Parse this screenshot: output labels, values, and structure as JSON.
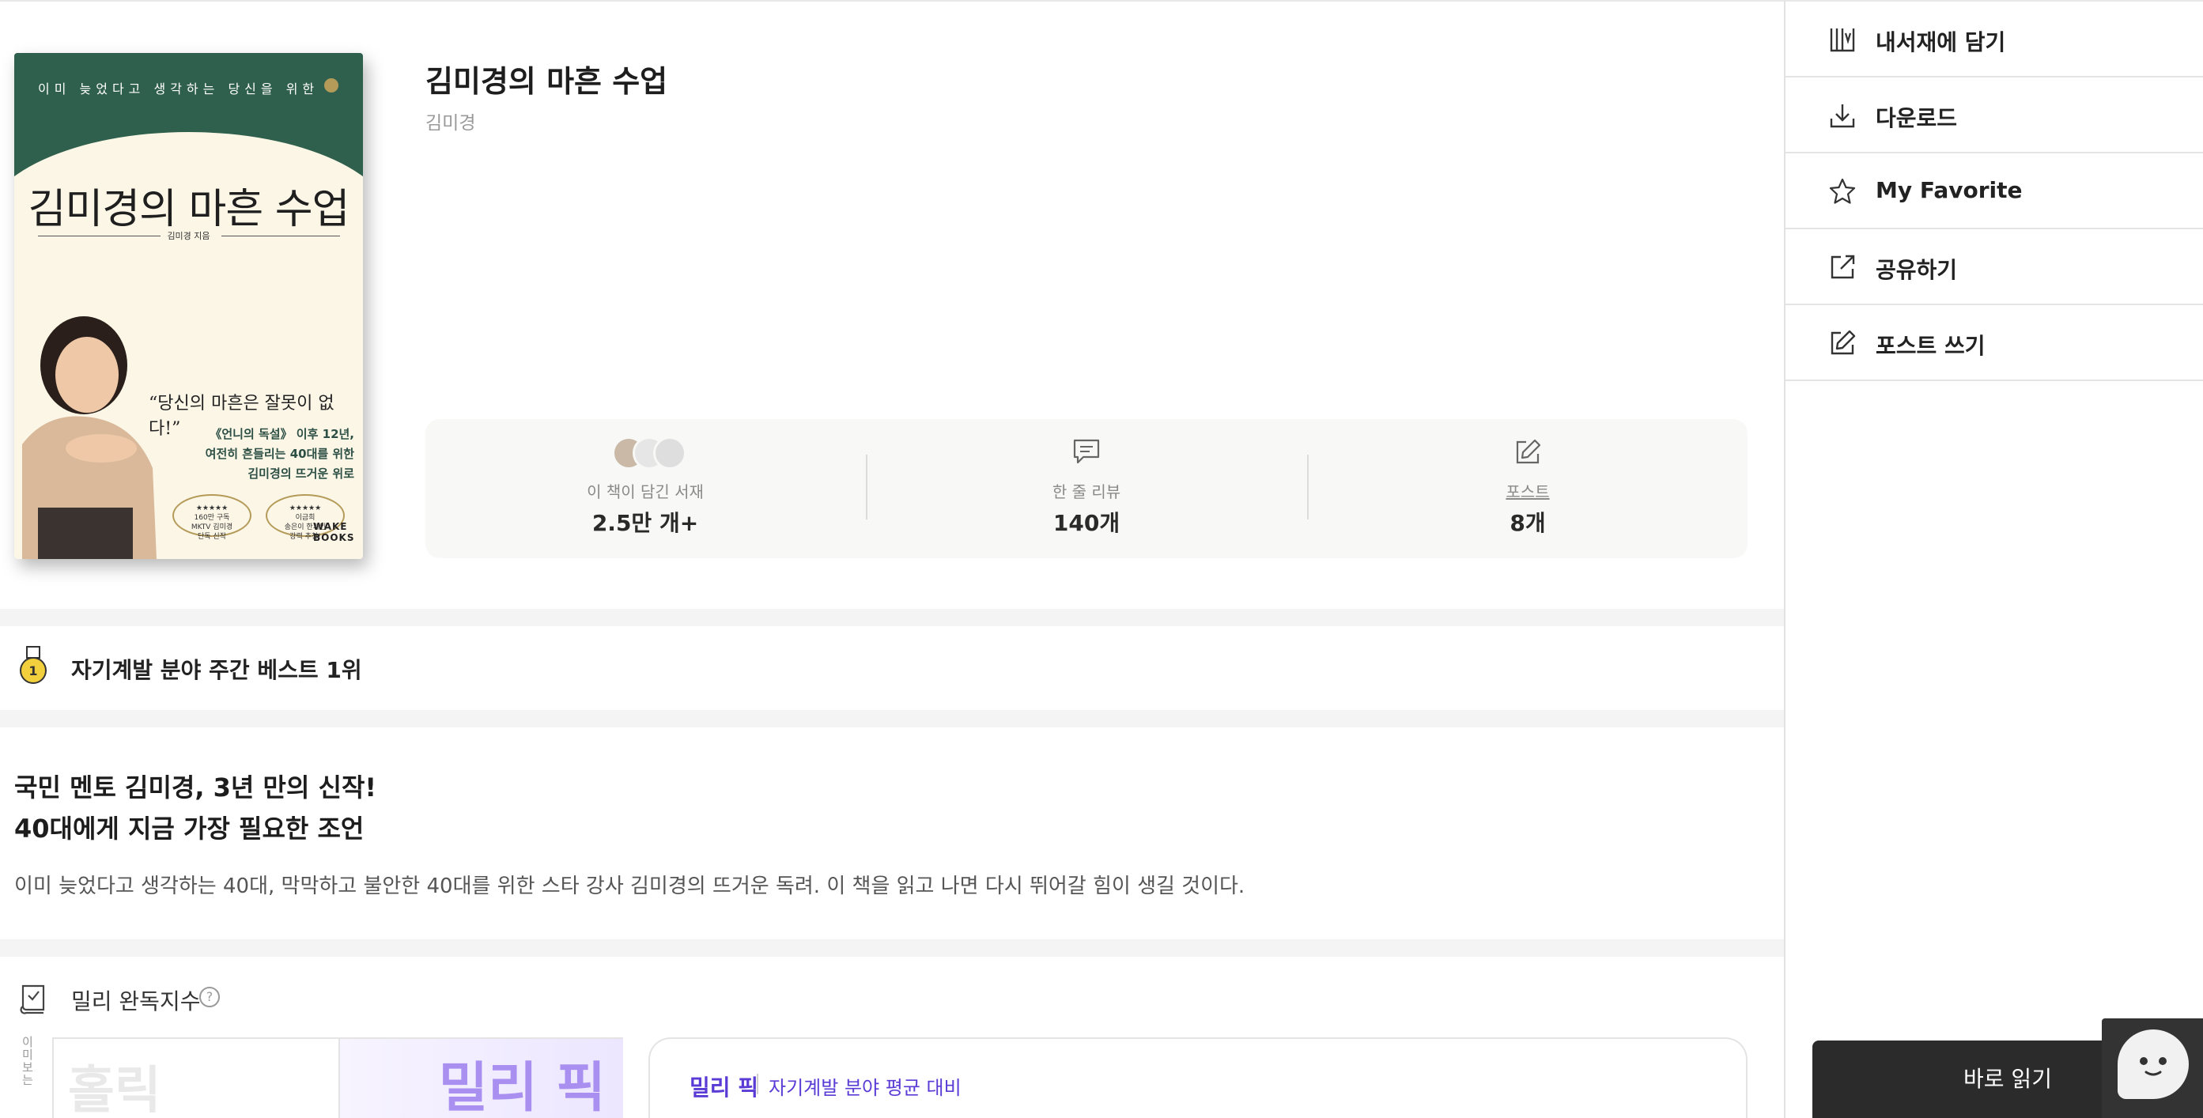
{
  "book": {
    "title": "김미경의 마흔 수업",
    "author": "김미경",
    "cover": {
      "tagline": "이미 늦었다고 생각하는 당신을 위한",
      "title": "김미경의 마흔 수업",
      "author_credit": "김미경 지음",
      "quote": "“당신의 마흔은 잘못이 없다!”",
      "sub_lines": [
        "《언니의 독설》 이후 12년,",
        "여전히 흔들리는 40대를 위한",
        "김미경의 뜨거운 위로"
      ],
      "badge_left": [
        "★★★★★",
        "160만 구독",
        "MKTV 김미경",
        "단독 신작"
      ],
      "badge_right": [
        "★★★★★",
        "이금희",
        "송은이 한가인",
        "강력 추천!"
      ],
      "publisher": "WAKE BOOKS"
    }
  },
  "stats": [
    {
      "label": "이 책이 담긴 서재",
      "value": "2.5만 개+"
    },
    {
      "label": "한 줄 리뷰",
      "value": "140개"
    },
    {
      "label": "포스트",
      "value": "8개"
    }
  ],
  "best": {
    "label": "자기계발 분야 주간 베스트 1위",
    "rank": "1"
  },
  "promo": {
    "line1": "국민 멘토 김미경, 3년 만의 신작!",
    "line2": "40대에게 지금 가장 필요한 조언",
    "desc": "이미 늦었다고 생각하는 40대, 막막하고 불안한 40대를 위한 스타 강사 김미경의 뜨거운 독려. 이 책을 읽고 나면 다시 뛰어갈 힘이 생길 것이다."
  },
  "read_index": {
    "title": "밀리 완독지수",
    "help": "?",
    "axis_label": "이미 보는",
    "left_label": "홀릭",
    "right_label": "밀리 픽",
    "card_pick": "밀리 픽",
    "card_sub": "자기계발 분야 평균 대비"
  },
  "sidebar": {
    "items": [
      {
        "label": "내서재에 담기",
        "icon": "library-add-icon"
      },
      {
        "label": "다운로드",
        "icon": "download-icon"
      },
      {
        "label": "My Favorite",
        "icon": "star-icon"
      },
      {
        "label": "공유하기",
        "icon": "share-icon"
      },
      {
        "label": "포스트 쓰기",
        "icon": "edit-icon"
      }
    ]
  },
  "cta": {
    "read_now": "바로 읽기"
  },
  "colors": {
    "accent": "#5a3bd6",
    "cover_green": "#2f5f4d",
    "dark_button": "#2b2b2b"
  }
}
